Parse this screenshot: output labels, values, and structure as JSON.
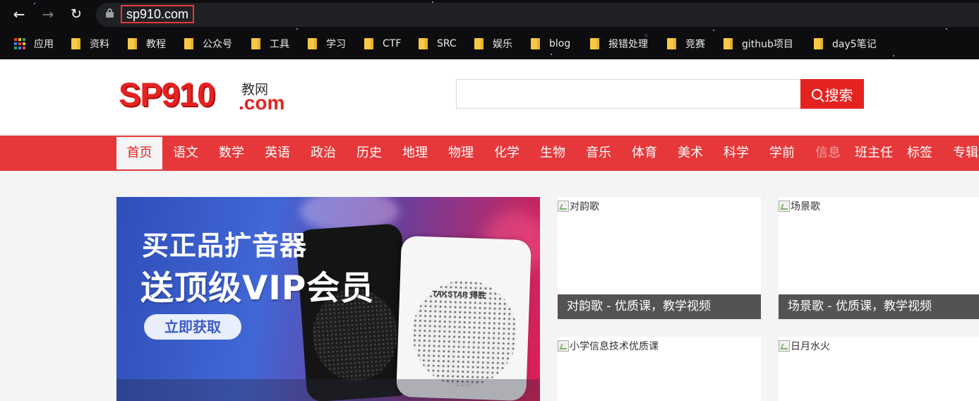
{
  "browser": {
    "url": "sp910.com",
    "bookmarks": [
      {
        "label": "应用",
        "icon": "apps-grid-icon"
      },
      {
        "label": "资料",
        "icon": "folder-icon"
      },
      {
        "label": "教程",
        "icon": "folder-icon"
      },
      {
        "label": "公众号",
        "icon": "folder-icon"
      },
      {
        "label": "工具",
        "icon": "folder-icon"
      },
      {
        "label": "学习",
        "icon": "folder-icon"
      },
      {
        "label": "CTF",
        "icon": "folder-icon"
      },
      {
        "label": "SRC",
        "icon": "folder-icon"
      },
      {
        "label": "娱乐",
        "icon": "folder-icon"
      },
      {
        "label": "blog",
        "icon": "folder-icon"
      },
      {
        "label": "报错处理",
        "icon": "folder-icon"
      },
      {
        "label": "竞赛",
        "icon": "folder-icon"
      },
      {
        "label": "github项目",
        "icon": "folder-icon"
      },
      {
        "label": "day5笔记",
        "icon": "folder-icon"
      }
    ]
  },
  "site": {
    "logo_main": "SP910",
    "logo_sub": "教网",
    "logo_com": ".com",
    "search": {
      "placeholder": "",
      "button_label": "搜索"
    },
    "nav": [
      {
        "label": "首页",
        "active": true
      },
      {
        "label": "语文"
      },
      {
        "label": "数学"
      },
      {
        "label": "英语"
      },
      {
        "label": "政治"
      },
      {
        "label": "历史"
      },
      {
        "label": "地理"
      },
      {
        "label": "物理"
      },
      {
        "label": "化学"
      },
      {
        "label": "生物"
      },
      {
        "label": "音乐"
      },
      {
        "label": "体育"
      },
      {
        "label": "美术"
      },
      {
        "label": "科学"
      },
      {
        "label": "学前"
      },
      {
        "label": "信息",
        "dim": true
      },
      {
        "label": "班主任"
      },
      {
        "label": "标签"
      },
      {
        "label": "专辑"
      }
    ],
    "banner": {
      "line1": "买正品扩音器",
      "line2": "送顶级VIP会员",
      "cta": "立即获取",
      "product_brand": "TAKSTAR 得胜"
    },
    "cards": [
      {
        "alt": "对韵歌",
        "caption": "对韵歌 - 优质课，教学视频"
      },
      {
        "alt": "场景歌",
        "caption": "场景歌 - 优质课，教学视频"
      },
      {
        "alt": "小学信息技术优质课",
        "caption": ""
      },
      {
        "alt": "日月水火",
        "caption": ""
      }
    ]
  },
  "colors": {
    "brand_red": "#e42321",
    "nav_red": "#e6383a",
    "caption_bg": "#535353"
  }
}
